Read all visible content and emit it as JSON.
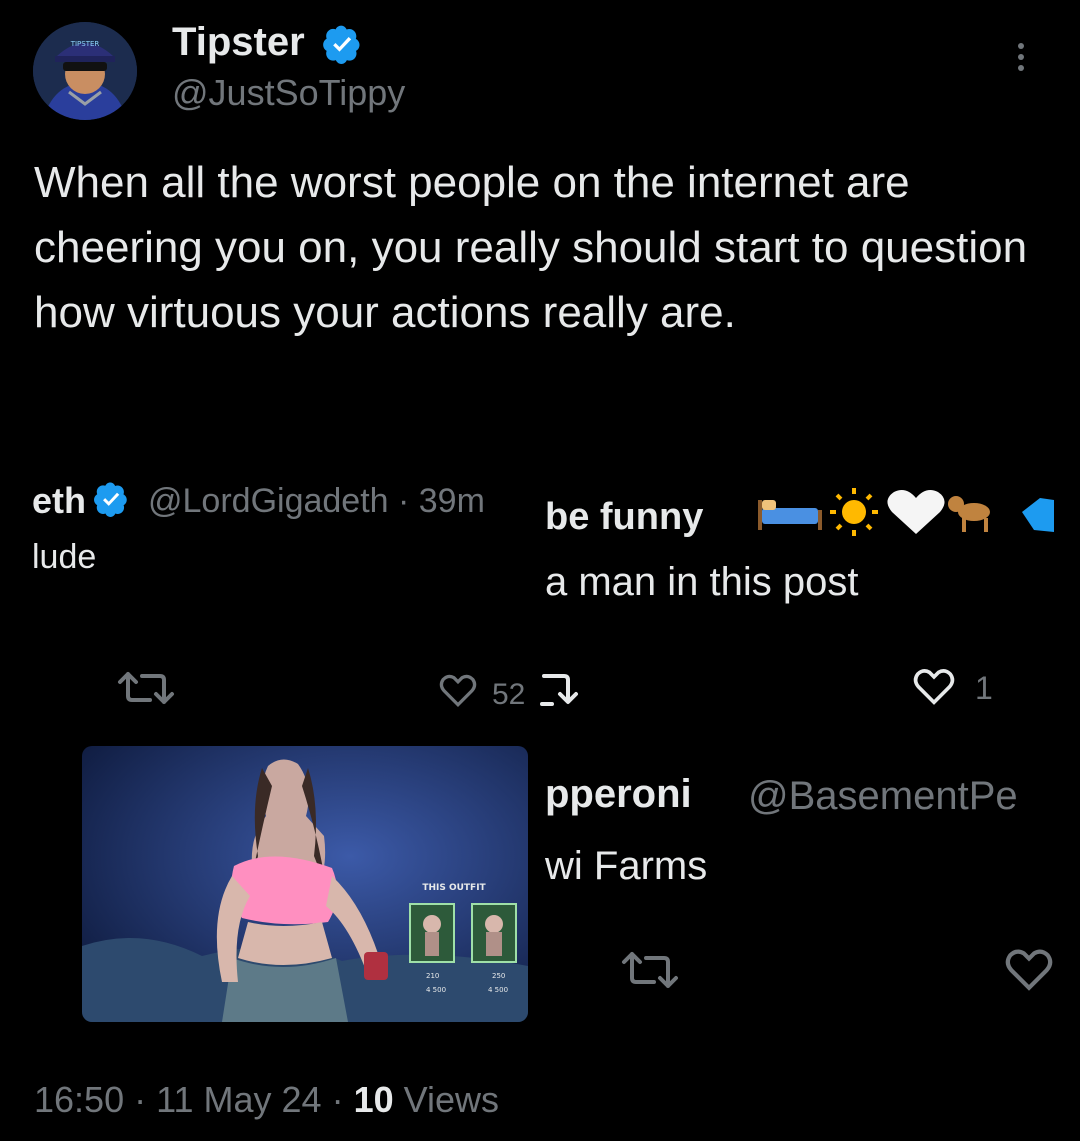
{
  "tweet": {
    "author_name": "Tipster",
    "author_handle": "@JustSoTippy",
    "avatar_text": "TIPSTER",
    "text": "When all the worst people on the internet are cheering you on, you really should start to question how virtuous your actions really are.",
    "time": "16:50",
    "date": "11 May 24",
    "views_count": "10",
    "views_label": "Views",
    "sep": "·"
  },
  "embedded": {
    "reply1": {
      "name_fragment": "eth",
      "handle": "@LordGigadeth · 39m",
      "text_fragment": "lude",
      "likes": "52"
    },
    "reply2": {
      "name_fragment": "be funny",
      "text_fragment": "a man in this post",
      "likes": "1"
    },
    "reply3": {
      "name_fragment": "pperoni",
      "handle_fragment": "@BasementPe",
      "text_fragment": "wi Farms"
    },
    "video": {
      "shop_label": "THIS OUTFIT",
      "price1": "210",
      "price1b": "4 500",
      "price2": "250",
      "price2b": "4 500"
    }
  },
  "colors": {
    "background": "#000000",
    "text": "#e7e9ea",
    "muted": "#71767b",
    "verified": "#1d9bf0"
  }
}
